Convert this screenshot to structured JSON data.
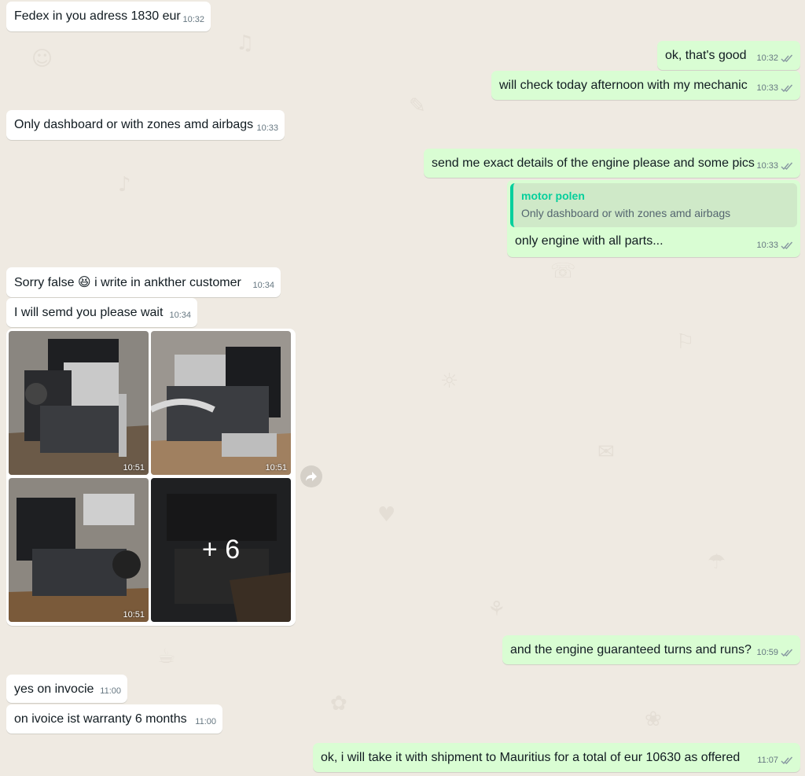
{
  "messages": {
    "m1": {
      "text": "Fedex in you adress 1830 eur",
      "time": "10:32"
    },
    "m2": {
      "text": "ok, that's good",
      "time": "10:32"
    },
    "m3": {
      "text": "will check today afternoon with my mechanic",
      "time": "10:33"
    },
    "m4": {
      "text": "Only dashboard or with zones amd airbags",
      "time": "10:33"
    },
    "m5": {
      "text": "send me exact details of the engine please and some pics",
      "time": "10:33"
    },
    "m6": {
      "quote_author": "motor polen",
      "quote_text": "Only dashboard or with zones amd airbags",
      "text": "only engine with all parts...",
      "time": "10:33"
    },
    "m7": {
      "text_before": "Sorry false",
      "emoji": "😆",
      "text_after": "i write in ankther customer",
      "time": "10:34"
    },
    "m8": {
      "text": "I will semd you please wait",
      "time": "10:34"
    },
    "album": {
      "photos": [
        {
          "time": "10:51"
        },
        {
          "time": "10:51"
        },
        {
          "time": "10:51"
        },
        {
          "more": "+ 6"
        }
      ]
    },
    "m9": {
      "text": "and the engine guaranteed turns and runs?",
      "time": "10:59"
    },
    "m10": {
      "text": "yes on invocie",
      "time": "11:00"
    },
    "m11": {
      "text": "on ivoice ist warranty 6 months",
      "time": "11:00"
    },
    "m12": {
      "text": "ok, i will take it with shipment to Mauritius for a total of eur 10630 as offered",
      "time": "11:07"
    }
  },
  "colors": {
    "background": "#efeae2",
    "incoming": "#ffffff",
    "outgoing": "#d9fdd3",
    "quote_accent": "#06cf9c",
    "read_tick": "#8696a0"
  },
  "icons": {
    "delivery_status": "double-check-icon",
    "forward": "forward-arrow-icon"
  }
}
